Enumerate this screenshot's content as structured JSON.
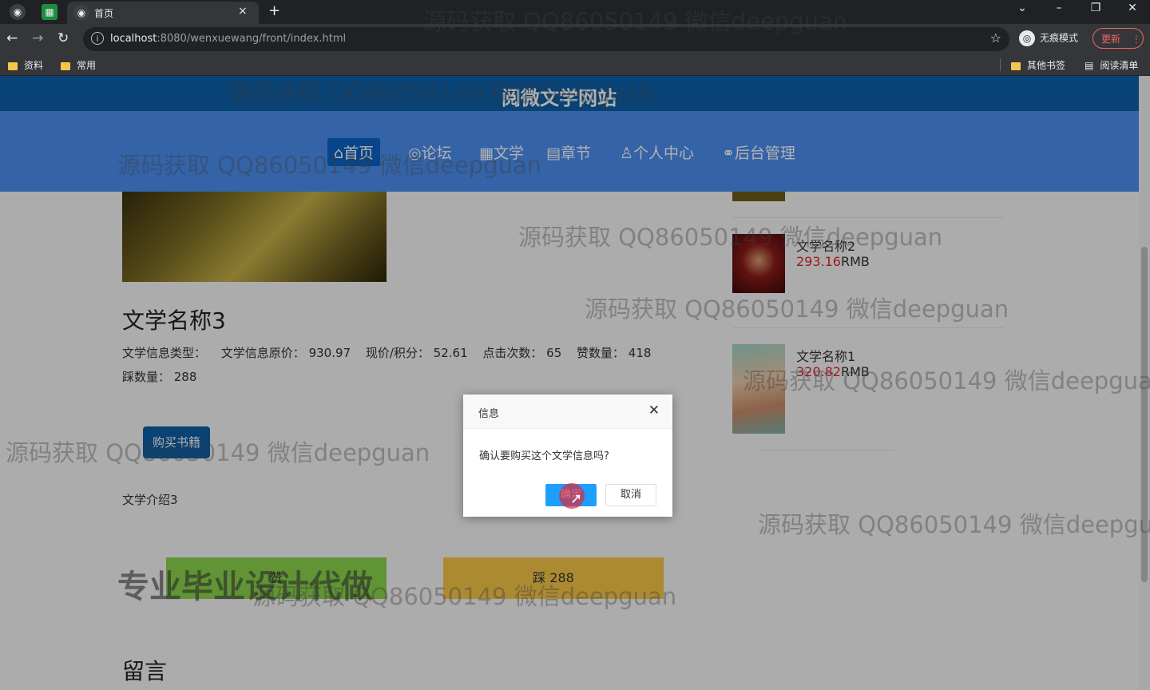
{
  "browser": {
    "tab_title": "首页",
    "tab_close": "×",
    "new_tab": "+",
    "url_host": "localhost",
    "url_rest": ":8080/wenxuewang/front/index.html",
    "incognito_label": "无痕模式",
    "update_label": "更新",
    "bookmarks": [
      "资料",
      "常用"
    ],
    "bookmarks_right": [
      "其他书签",
      "阅读清单"
    ]
  },
  "site": {
    "title": "阅微文学网站",
    "nav": [
      "⌂首页",
      "◎论坛",
      "▦文学",
      "▤章节",
      "♙个人中心",
      "⚭后台管理"
    ]
  },
  "book": {
    "title": "文学名称3",
    "meta": [
      "文学信息类型：",
      "文学信息原价：  930.97",
      "现价/积分：  52.61",
      "点击次数：  65",
      "赞数量：  418",
      "踩数量：  288"
    ],
    "buy_label": "购买书籍",
    "intro": "文学介绍3",
    "like_label": "赞",
    "dislike_label": "踩  288",
    "comments_title": "留言"
  },
  "recommend": [
    {
      "name": "文学名称2",
      "price": "293.16",
      "unit": "RMB"
    },
    {
      "name": "文学名称1",
      "price": "320.82",
      "unit": "RMB"
    }
  ],
  "dialog": {
    "title": "信息",
    "message": "确认要购买这个文学信息吗?",
    "ok_label": "确定",
    "cancel_label": "取消",
    "close": "✕"
  },
  "watermark": "源码获取 QQ86050149 微信deepguan",
  "promo": "专业毕业设计代做",
  "colors": {
    "nav_bg": "#4b8ef0",
    "header_bg": "#0e5fa6",
    "price_red": "#e3242b",
    "ok_btn": "#1e9fff"
  }
}
